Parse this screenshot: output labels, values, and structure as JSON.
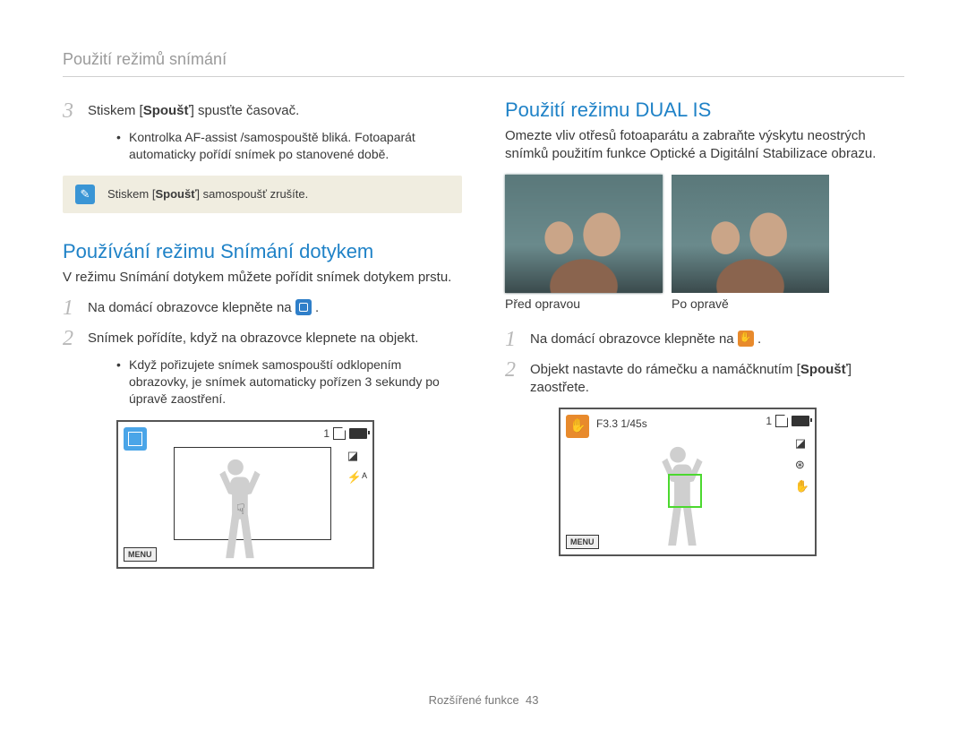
{
  "breadcrumb": "Použití režimů snímání",
  "left": {
    "step3_before": "Stiskem [",
    "step3_bold": "Spoušť",
    "step3_after": "] spusťte časovač.",
    "bullet1": "Kontrolka AF-assist /samospouště bliká. Fotoaparát automaticky pořídí snímek po stanovené době.",
    "note_before": "Stiskem [",
    "note_bold": "Spoušť",
    "note_after": "] samospoušť zrušíte.",
    "section": "Používání režimu Snímání dotykem",
    "intro": "V režimu Snímání dotykem můžete pořídit snímek dotykem prstu.",
    "step1": "Na domácí obrazovce klepněte na",
    "step2": "Snímek pořídíte, když na obrazovce klepnete na objekt.",
    "bullet2": "Když pořizujete snímek samospouští odklopením obrazovky, je snímek automaticky pořízen 3 sekundy po úpravě zaostření."
  },
  "right": {
    "section": "Použití režimu DUAL IS",
    "intro": "Omezte vliv otřesů fotoaparátu a zabraňte výskytu neostrých snímků použitím funkce Optické a Digitální Stabilizace obrazu.",
    "label_before": "Před opravou",
    "label_after": "Po opravě",
    "step1": "Na domácí obrazovce klepněte na",
    "step2_before": "Objekt nastavte do rámečku a namáčknutím [",
    "step2_bold": "Spoušť",
    "step2_after": "] zaostřete."
  },
  "ui": {
    "count": "1",
    "menu": "MENU",
    "exposure": "F3.3  1/45s"
  },
  "footer": {
    "label": "Rozšířené funkce",
    "page": "43"
  }
}
